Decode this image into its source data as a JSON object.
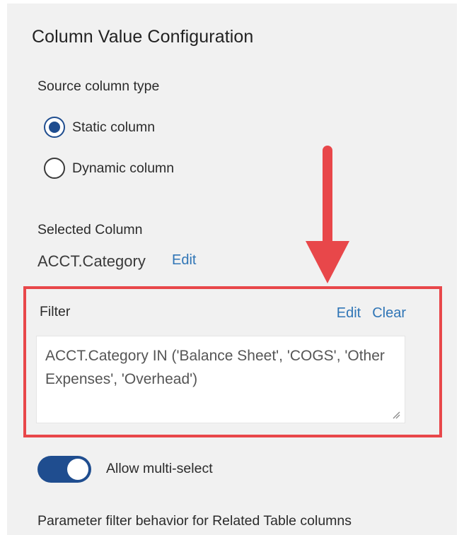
{
  "panel": {
    "title": "Column Value Configuration"
  },
  "source_column_type": {
    "label": "Source column type",
    "options": [
      {
        "label": "Static column",
        "selected": true
      },
      {
        "label": "Dynamic column",
        "selected": false
      }
    ]
  },
  "selected_column": {
    "label": "Selected Column",
    "value": "ACCT.Category",
    "edit_label": "Edit"
  },
  "filter": {
    "label": "Filter",
    "edit_label": "Edit",
    "clear_label": "Clear",
    "expression": "ACCT.Category IN ('Balance Sheet', 'COGS', 'Other Expenses', 'Overhead')"
  },
  "multi_select": {
    "label": "Allow multi-select",
    "enabled": true
  },
  "parameter_filter": {
    "label": "Parameter filter behavior for Related Table columns"
  },
  "colors": {
    "accent": "#1f4d8f",
    "link": "#2f75b6",
    "highlight": "#e8474a",
    "panel_background": "#f1f1f1"
  }
}
